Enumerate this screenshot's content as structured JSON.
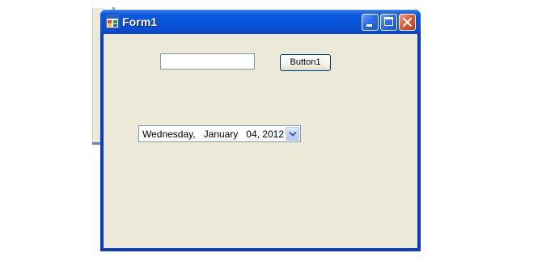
{
  "window": {
    "title": "Form1"
  },
  "form": {
    "textbox_value": "",
    "button_label": "Button1",
    "date_value": "Wednesday,   January   04, 2012"
  },
  "icons": {
    "app": "form-app-icon",
    "minimize": "minimize-icon",
    "maximize": "maximize-icon",
    "close": "close-icon",
    "dropdown": "chevron-down-icon"
  },
  "colors": {
    "titlebar": "#0652d8",
    "client_bg": "#ece9d8",
    "close_button": "#e05e36"
  }
}
